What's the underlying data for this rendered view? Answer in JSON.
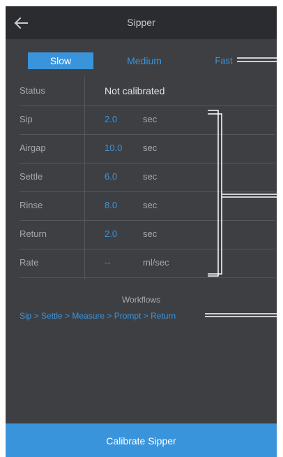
{
  "header": {
    "title": "Sipper",
    "back_icon": "arrow-left-icon"
  },
  "speed": {
    "options": [
      "Slow",
      "Medium",
      "Fast"
    ],
    "selected": "Slow"
  },
  "table": {
    "rows": [
      {
        "label": "Status",
        "value": "Not calibrated",
        "unit": ""
      },
      {
        "label": "Sip",
        "value": "2.0",
        "unit": "sec"
      },
      {
        "label": "Airgap",
        "value": "10.0",
        "unit": "sec"
      },
      {
        "label": "Settle",
        "value": "6.0",
        "unit": "sec"
      },
      {
        "label": "Rinse",
        "value": "8.0",
        "unit": "sec"
      },
      {
        "label": "Return",
        "value": "2.0",
        "unit": "sec"
      },
      {
        "label": "Rate",
        "value": "--",
        "unit": "ml/sec"
      }
    ]
  },
  "workflows": {
    "label": "Workflows",
    "text": "Sip > Settle > Measure > Prompt > Return"
  },
  "footer": {
    "button_label": "Calibrate Sipper"
  },
  "colors": {
    "background": "#3e3f42",
    "topbar": "#2b2c2f",
    "accent": "#3a94dc"
  }
}
